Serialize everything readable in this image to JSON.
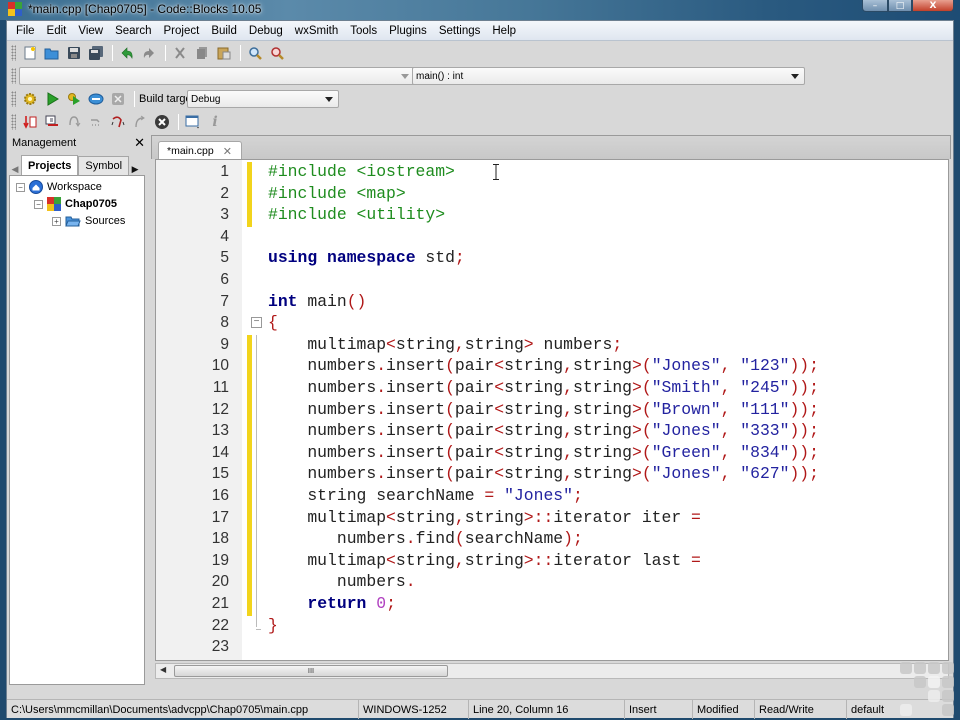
{
  "window": {
    "title": "*main.cpp [Chap0705] - Code::Blocks 10.05",
    "controls": {
      "minimize": "–",
      "maximize": "□",
      "close": "X"
    }
  },
  "menu": [
    "File",
    "Edit",
    "View",
    "Search",
    "Project",
    "Build",
    "Debug",
    "wxSmith",
    "Tools",
    "Plugins",
    "Settings",
    "Help"
  ],
  "toolbar_main": {
    "icons": [
      "new-file-icon",
      "open-icon",
      "save-icon",
      "save-all-icon",
      "undo-icon",
      "redo-icon",
      "cut-icon",
      "copy-icon",
      "paste-icon",
      "find-icon",
      "replace-icon"
    ]
  },
  "code_completion": {
    "scope_value": "",
    "function_value": "main() : int"
  },
  "build_toolbar": {
    "icons": [
      "build-icon",
      "run-icon",
      "build-and-run-icon",
      "rebuild-icon",
      "abort-icon"
    ],
    "target_label": "Build target:",
    "target_value": "Debug"
  },
  "debug_toolbar": {
    "icons": [
      "debug-run-icon",
      "run-to-cursor-icon",
      "next-line-icon",
      "next-instruction-icon",
      "step-into-icon",
      "step-out-icon",
      "stop-debugger-icon",
      "debug-windows-icon",
      "info-icon"
    ]
  },
  "management": {
    "title": "Management",
    "close": "✕",
    "tabs": [
      "Projects",
      "Symbol"
    ],
    "active_tab": "Projects",
    "tree": [
      {
        "label": "Workspace",
        "expander": "−",
        "bold": false
      },
      {
        "label": "Chap0705",
        "expander": "−",
        "bold": true
      },
      {
        "label": "Sources",
        "expander": "+",
        "bold": false
      }
    ]
  },
  "editor": {
    "tab_label": "*main.cpp",
    "tab_close": "✕",
    "lines": [
      {
        "n": "1",
        "tokens": [
          [
            "pp",
            "#include <iostream>"
          ]
        ]
      },
      {
        "n": "2",
        "tokens": [
          [
            "pp",
            "#include <map>"
          ]
        ]
      },
      {
        "n": "3",
        "tokens": [
          [
            "pp",
            "#include <utility>"
          ]
        ]
      },
      {
        "n": "4",
        "tokens": []
      },
      {
        "n": "5",
        "tokens": [
          [
            "kw",
            "using"
          ],
          [
            "id",
            " "
          ],
          [
            "kw",
            "namespace"
          ],
          [
            "id",
            " std"
          ],
          [
            "op",
            ";"
          ]
        ]
      },
      {
        "n": "6",
        "tokens": []
      },
      {
        "n": "7",
        "tokens": [
          [
            "kw",
            "int"
          ],
          [
            "id",
            " main"
          ],
          [
            "op",
            "()"
          ]
        ]
      },
      {
        "n": "8",
        "tokens": [
          [
            "op",
            "{"
          ]
        ]
      },
      {
        "n": "9",
        "tokens": [
          [
            "id",
            "    multimap"
          ],
          [
            "op",
            "<"
          ],
          [
            "id",
            "string"
          ],
          [
            "op",
            ","
          ],
          [
            "id",
            "string"
          ],
          [
            "op",
            ">"
          ],
          [
            "id",
            " numbers"
          ],
          [
            "op",
            ";"
          ]
        ]
      },
      {
        "n": "10",
        "tokens": [
          [
            "id",
            "    numbers"
          ],
          [
            "op",
            "."
          ],
          [
            "id",
            "insert"
          ],
          [
            "op",
            "("
          ],
          [
            "id",
            "pair"
          ],
          [
            "op",
            "<"
          ],
          [
            "id",
            "string"
          ],
          [
            "op",
            ","
          ],
          [
            "id",
            "string"
          ],
          [
            "op",
            ">("
          ],
          [
            "str",
            "\"Jones\""
          ],
          [
            "op",
            ","
          ],
          [
            "id",
            " "
          ],
          [
            "str",
            "\"123\""
          ],
          [
            "op",
            "));"
          ]
        ]
      },
      {
        "n": "11",
        "tokens": [
          [
            "id",
            "    numbers"
          ],
          [
            "op",
            "."
          ],
          [
            "id",
            "insert"
          ],
          [
            "op",
            "("
          ],
          [
            "id",
            "pair"
          ],
          [
            "op",
            "<"
          ],
          [
            "id",
            "string"
          ],
          [
            "op",
            ","
          ],
          [
            "id",
            "string"
          ],
          [
            "op",
            ">("
          ],
          [
            "str",
            "\"Smith\""
          ],
          [
            "op",
            ","
          ],
          [
            "id",
            " "
          ],
          [
            "str",
            "\"245\""
          ],
          [
            "op",
            "));"
          ]
        ]
      },
      {
        "n": "12",
        "tokens": [
          [
            "id",
            "    numbers"
          ],
          [
            "op",
            "."
          ],
          [
            "id",
            "insert"
          ],
          [
            "op",
            "("
          ],
          [
            "id",
            "pair"
          ],
          [
            "op",
            "<"
          ],
          [
            "id",
            "string"
          ],
          [
            "op",
            ","
          ],
          [
            "id",
            "string"
          ],
          [
            "op",
            ">("
          ],
          [
            "str",
            "\"Brown\""
          ],
          [
            "op",
            ","
          ],
          [
            "id",
            " "
          ],
          [
            "str",
            "\"111\""
          ],
          [
            "op",
            "));"
          ]
        ]
      },
      {
        "n": "13",
        "tokens": [
          [
            "id",
            "    numbers"
          ],
          [
            "op",
            "."
          ],
          [
            "id",
            "insert"
          ],
          [
            "op",
            "("
          ],
          [
            "id",
            "pair"
          ],
          [
            "op",
            "<"
          ],
          [
            "id",
            "string"
          ],
          [
            "op",
            ","
          ],
          [
            "id",
            "string"
          ],
          [
            "op",
            ">("
          ],
          [
            "str",
            "\"Jones\""
          ],
          [
            "op",
            ","
          ],
          [
            "id",
            " "
          ],
          [
            "str",
            "\"333\""
          ],
          [
            "op",
            "));"
          ]
        ]
      },
      {
        "n": "14",
        "tokens": [
          [
            "id",
            "    numbers"
          ],
          [
            "op",
            "."
          ],
          [
            "id",
            "insert"
          ],
          [
            "op",
            "("
          ],
          [
            "id",
            "pair"
          ],
          [
            "op",
            "<"
          ],
          [
            "id",
            "string"
          ],
          [
            "op",
            ","
          ],
          [
            "id",
            "string"
          ],
          [
            "op",
            ">("
          ],
          [
            "str",
            "\"Green\""
          ],
          [
            "op",
            ","
          ],
          [
            "id",
            " "
          ],
          [
            "str",
            "\"834\""
          ],
          [
            "op",
            "));"
          ]
        ]
      },
      {
        "n": "15",
        "tokens": [
          [
            "id",
            "    numbers"
          ],
          [
            "op",
            "."
          ],
          [
            "id",
            "insert"
          ],
          [
            "op",
            "("
          ],
          [
            "id",
            "pair"
          ],
          [
            "op",
            "<"
          ],
          [
            "id",
            "string"
          ],
          [
            "op",
            ","
          ],
          [
            "id",
            "string"
          ],
          [
            "op",
            ">("
          ],
          [
            "str",
            "\"Jones\""
          ],
          [
            "op",
            ","
          ],
          [
            "id",
            " "
          ],
          [
            "str",
            "\"627\""
          ],
          [
            "op",
            "));"
          ]
        ]
      },
      {
        "n": "16",
        "tokens": [
          [
            "id",
            "    string searchName "
          ],
          [
            "op",
            "="
          ],
          [
            "id",
            " "
          ],
          [
            "str",
            "\"Jones\""
          ],
          [
            "op",
            ";"
          ]
        ]
      },
      {
        "n": "17",
        "tokens": [
          [
            "id",
            "    multimap"
          ],
          [
            "op",
            "<"
          ],
          [
            "id",
            "string"
          ],
          [
            "op",
            ","
          ],
          [
            "id",
            "string"
          ],
          [
            "op",
            ">::"
          ],
          [
            "id",
            "iterator iter "
          ],
          [
            "op",
            "="
          ]
        ]
      },
      {
        "n": "18",
        "tokens": [
          [
            "id",
            "       numbers"
          ],
          [
            "op",
            "."
          ],
          [
            "id",
            "find"
          ],
          [
            "op",
            "("
          ],
          [
            "id",
            "searchName"
          ],
          [
            "op",
            ");"
          ]
        ]
      },
      {
        "n": "19",
        "tokens": [
          [
            "id",
            "    multimap"
          ],
          [
            "op",
            "<"
          ],
          [
            "id",
            "string"
          ],
          [
            "op",
            ","
          ],
          [
            "id",
            "string"
          ],
          [
            "op",
            ">::"
          ],
          [
            "id",
            "iterator last "
          ],
          [
            "op",
            "="
          ]
        ]
      },
      {
        "n": "20",
        "tokens": [
          [
            "id",
            "       numbers"
          ],
          [
            "op",
            "."
          ]
        ]
      },
      {
        "n": "21",
        "tokens": [
          [
            "id",
            "    "
          ],
          [
            "kw",
            "return"
          ],
          [
            "id",
            " "
          ],
          [
            "num",
            "0"
          ],
          [
            "op",
            ";"
          ]
        ]
      },
      {
        "n": "22",
        "tokens": [
          [
            "op",
            "}"
          ]
        ]
      },
      {
        "n": "23",
        "tokens": []
      }
    ],
    "modified_lines": [
      "1",
      "2",
      "3",
      "9",
      "10",
      "11",
      "12",
      "13",
      "14",
      "15",
      "16",
      "17",
      "18",
      "19",
      "20",
      "21"
    ],
    "fold_marker_line": "8",
    "scroll_thumb_label": "III"
  },
  "status": {
    "path": "C:\\Users\\mmcmillan\\Documents\\advcpp\\Chap0705\\main.cpp",
    "encoding": "WINDOWS-1252",
    "position": "Line 20, Column 16",
    "mode": "Insert",
    "modified": "Modified",
    "access": "Read/Write",
    "profile": "default"
  },
  "colors": {
    "preprocessor": "#1e8c1e",
    "keyword": "#00007f",
    "operator": "#b01818",
    "string": "#2323a0",
    "number": "#b040c0",
    "change_bar": "#f2d41c"
  }
}
